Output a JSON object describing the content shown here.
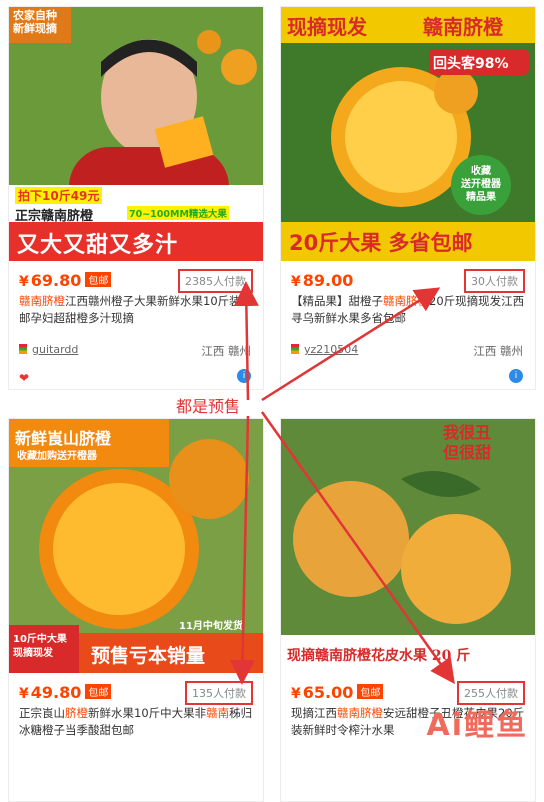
{
  "products": [
    {
      "price_symbol": "¥",
      "price": "69.80",
      "tag": "包邮",
      "sold": "2385人付款",
      "title_hl": "赣南脐橙",
      "title_rest": "江西赣州橙子大果新鲜水果10斤装包邮孕妇超甜橙多汁现摘",
      "shop": "guitardd",
      "location": "江西 赣州",
      "img_text": {
        "corner": "农家自种\n新鲜现摘",
        "badge": "拍下10斤49元",
        "line1": "正宗赣南脐橙",
        "size": "70~100MM精选大果",
        "bottom": "又大又甜又多汁"
      }
    },
    {
      "price_symbol": "¥",
      "price": "89.00",
      "tag": "",
      "sold": "30人付款",
      "title_pre": "【精品果】甜橙子",
      "title_hl": "赣南脐橙",
      "title_rest": "20斤现摘现发江西寻乌新鲜水果多省包邮",
      "shop": "yz210504",
      "location": "江西 赣州",
      "img_text": {
        "top_left": "现摘现发",
        "top_right": "赣南脐橙",
        "repeat": "回头客98%",
        "circle": "收藏\n送开橙器\n精品果",
        "bottom": "20斤大果 多省包邮"
      }
    },
    {
      "price_symbol": "¥",
      "price": "49.80",
      "tag": "包邮",
      "sold": "135人付款",
      "title_pre": "正宗崀山",
      "title_hl": "脐橙",
      "title_mid": "新鲜水果10斤中大果非",
      "title_hl2": "赣南",
      "title_rest": "秭归冰糖橙子当季酸甜包邮",
      "img_text": {
        "top": "新鲜崀山脐橙",
        "sub": "收藏加购送开橙器",
        "date": "11月中旬发货",
        "corner": "10斤中大果\n现摘现发",
        "bottom": "预售亏本销量"
      }
    },
    {
      "price_symbol": "¥",
      "price": "65.00",
      "tag": "包邮",
      "sold": "255人付款",
      "title_pre": "现摘江西",
      "title_hl": "赣南脐橙",
      "title_rest": "安远甜橙子丑橙花皮果20斤装新鲜时令榨汁水果",
      "img_text": {
        "top": "我很丑\n但很甜",
        "bottom": "现摘赣南脐橙花皮水果 20 斤"
      }
    }
  ],
  "annotation": "都是预售",
  "watermark": "Ai鲤鱼"
}
